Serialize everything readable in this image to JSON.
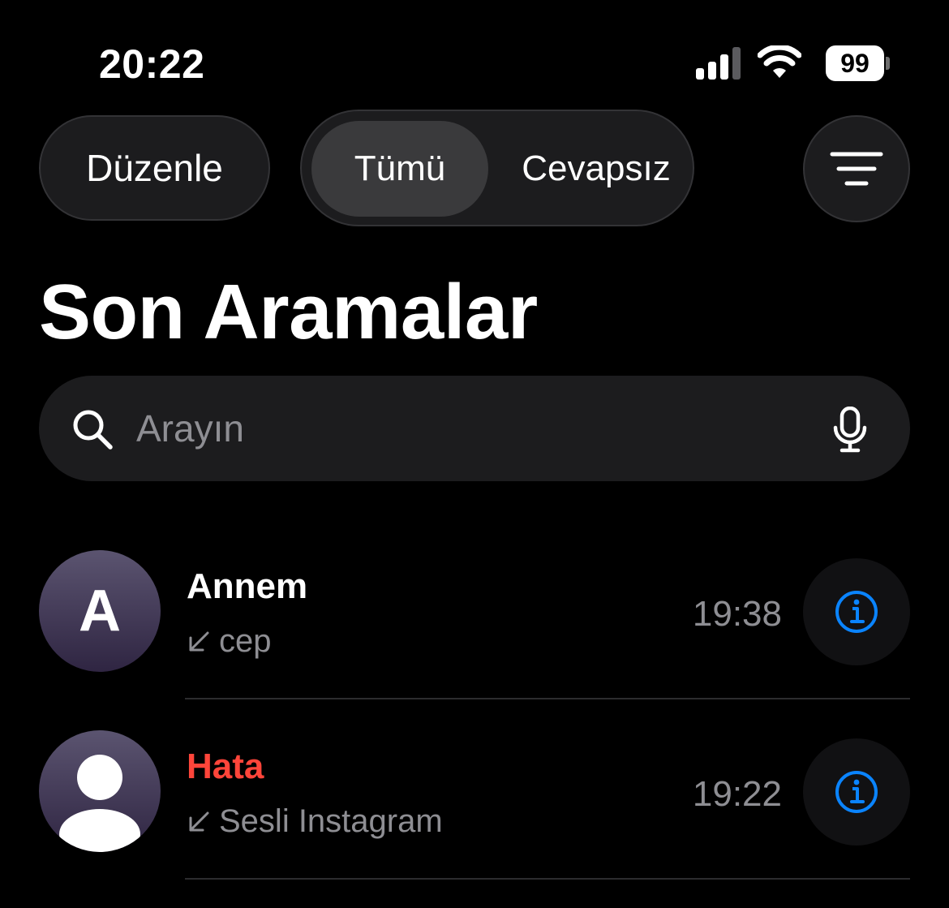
{
  "status_bar": {
    "time": "20:22",
    "battery_level": "99",
    "icons": [
      "signal-icon",
      "wifi-icon",
      "battery-icon"
    ]
  },
  "toolbar": {
    "edit_label": "Düzenle",
    "segments": [
      "Tümü",
      "Cevapsız"
    ],
    "selected_segment": "Tümü",
    "filter_icon": "filter-lines-icon"
  },
  "page": {
    "title": "Son Aramalar"
  },
  "search": {
    "placeholder": "Arayın",
    "value": "",
    "icons": [
      "search-icon",
      "mic-icon"
    ]
  },
  "calls": [
    {
      "name": "Annem",
      "avatar_letter": "A",
      "type_label": "cep",
      "time": "19:38",
      "missed": false,
      "direction_icon": "incoming-arrow-icon",
      "action_icon": "info-icon"
    },
    {
      "name": "Hata",
      "avatar_letter": "",
      "type_label": "Sesli Instagram",
      "time": "19:22",
      "missed": true,
      "direction_icon": "incoming-arrow-icon",
      "action_icon": "info-icon"
    }
  ],
  "colors": {
    "background": "#000000",
    "surface": "#1c1c1e",
    "accent": "#0a84ff",
    "missed": "#ff453a",
    "secondary_text": "#8e8e93"
  }
}
